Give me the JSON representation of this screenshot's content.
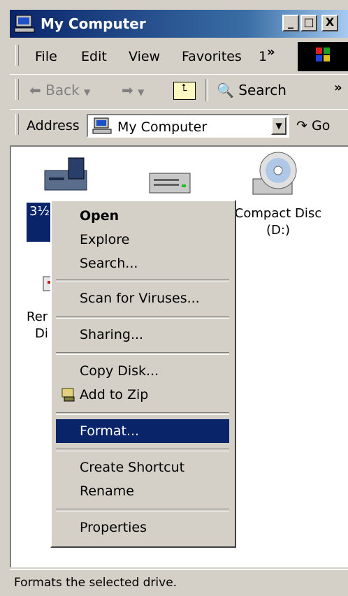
{
  "window": {
    "title": "My Computer"
  },
  "menubar": {
    "items": [
      "File",
      "Edit",
      "View",
      "Favorites",
      "1"
    ],
    "more": "»"
  },
  "toolbar": {
    "back_label": "Back",
    "search_label": "Search",
    "more": "»"
  },
  "address": {
    "label": "Address",
    "value": "My Computer",
    "go_label": "Go"
  },
  "content": {
    "icons": [
      {
        "name": "floppy-drive",
        "label": "3½"
      },
      {
        "name": "hard-drive",
        "label": ""
      },
      {
        "name": "compact-disc",
        "label_line1": "Compact Disc",
        "label_line2": "(D:)"
      },
      {
        "name": "removable-disk",
        "label_line1": "Rer",
        "label_line2": "Di"
      }
    ]
  },
  "context_menu": {
    "items": [
      {
        "label": "Open",
        "bold": true
      },
      {
        "label": "Explore"
      },
      {
        "label": "Search..."
      },
      {
        "label": "Scan for Viruses..."
      },
      {
        "label": "Sharing..."
      },
      {
        "label": "Copy Disk..."
      },
      {
        "label": "Add to Zip",
        "icon": "zip-icon"
      },
      {
        "label": "Format...",
        "highlighted": true
      },
      {
        "label": "Create Shortcut"
      },
      {
        "label": "Rename"
      },
      {
        "label": "Properties"
      }
    ]
  },
  "status": {
    "text": "Formats the selected drive."
  }
}
